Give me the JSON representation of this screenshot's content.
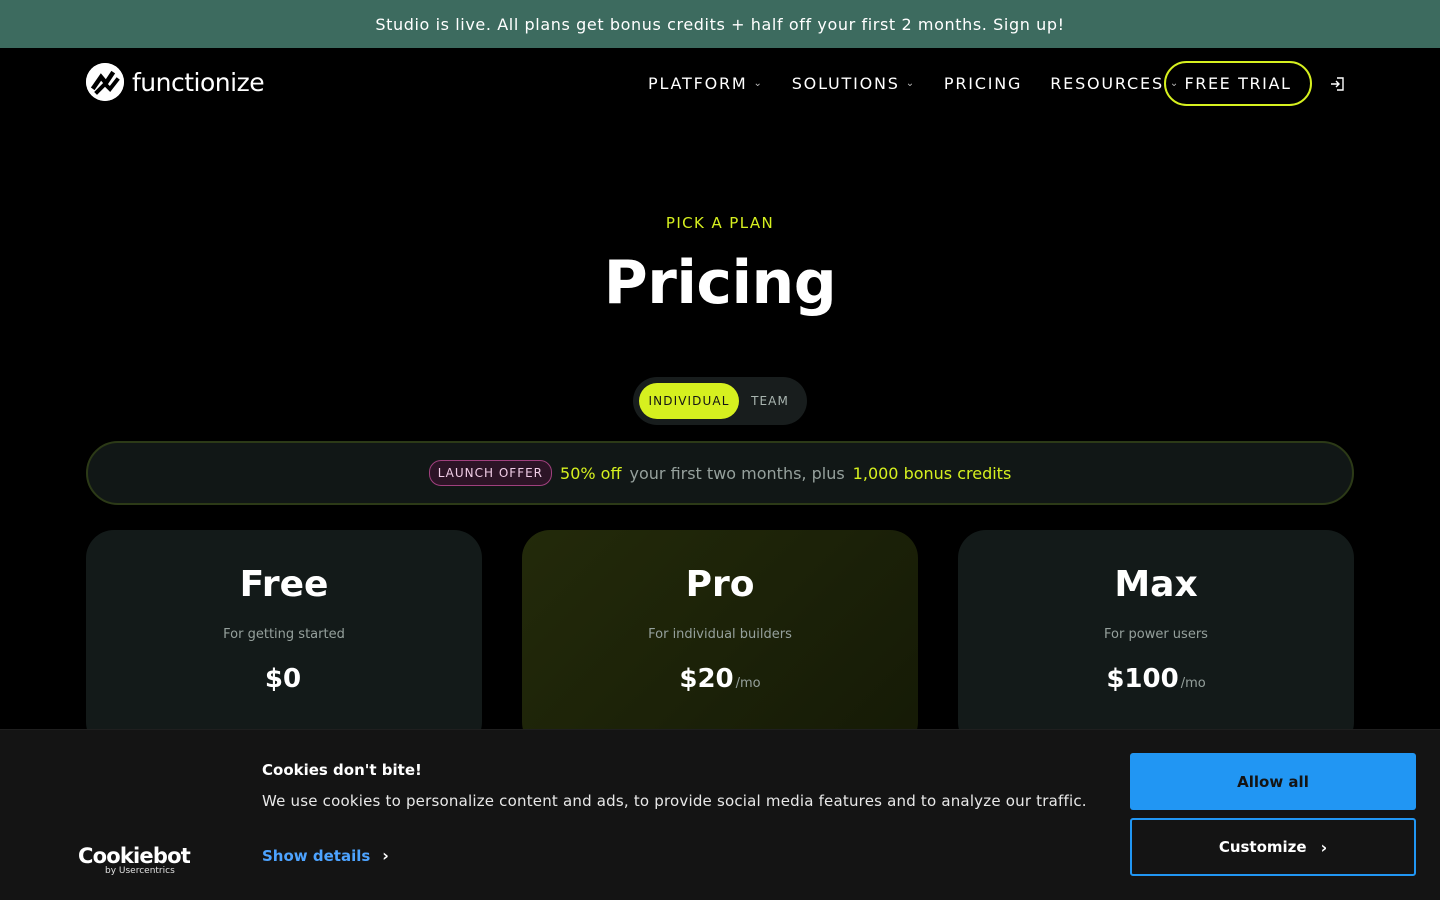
{
  "announcement": {
    "text": "Studio is live. All plans get bonus credits + half off your first 2 months. Sign up!"
  },
  "header": {
    "logo_text": "functionize",
    "nav": [
      {
        "label": "PLATFORM",
        "has_dropdown": true
      },
      {
        "label": "SOLUTIONS",
        "has_dropdown": true
      },
      {
        "label": "PRICING",
        "has_dropdown": false
      },
      {
        "label": "RESOURCES",
        "has_dropdown": true
      }
    ],
    "trial_label": "FREE TRIAL",
    "login_icon": "login-icon"
  },
  "hero": {
    "eyebrow": "PICK A PLAN",
    "title": "Pricing"
  },
  "toggle": {
    "individual": "INDIVIDUAL",
    "team": "TEAM",
    "selected": "INDIVIDUAL"
  },
  "offer": {
    "badge": "LAUNCH OFFER",
    "percent": "50% off",
    "middle": "your first two months, plus",
    "credits": "1,000 bonus credits"
  },
  "plans": [
    {
      "name": "Free",
      "subtitle": "For getting started",
      "price": "$0",
      "period": ""
    },
    {
      "name": "Pro",
      "subtitle": "For individual builders",
      "price": "$20",
      "period": "/mo"
    },
    {
      "name": "Max",
      "subtitle": "For power users",
      "price": "$100",
      "period": "/mo"
    }
  ],
  "cookie": {
    "title": "Cookies don't bite!",
    "text": "We use cookies to personalize content and ads, to provide social media features and to analyze our traffic.",
    "show_details": "Show details",
    "allow_all": "Allow all",
    "customize": "Customize",
    "brand": "Cookiebot",
    "brand_sub": "by Usercentrics"
  },
  "colors": {
    "accent": "#d6f01f",
    "announcement_bg": "#3d6b5f",
    "cookie_blue": "#2196f3",
    "offer_badge": "#a0407e"
  }
}
